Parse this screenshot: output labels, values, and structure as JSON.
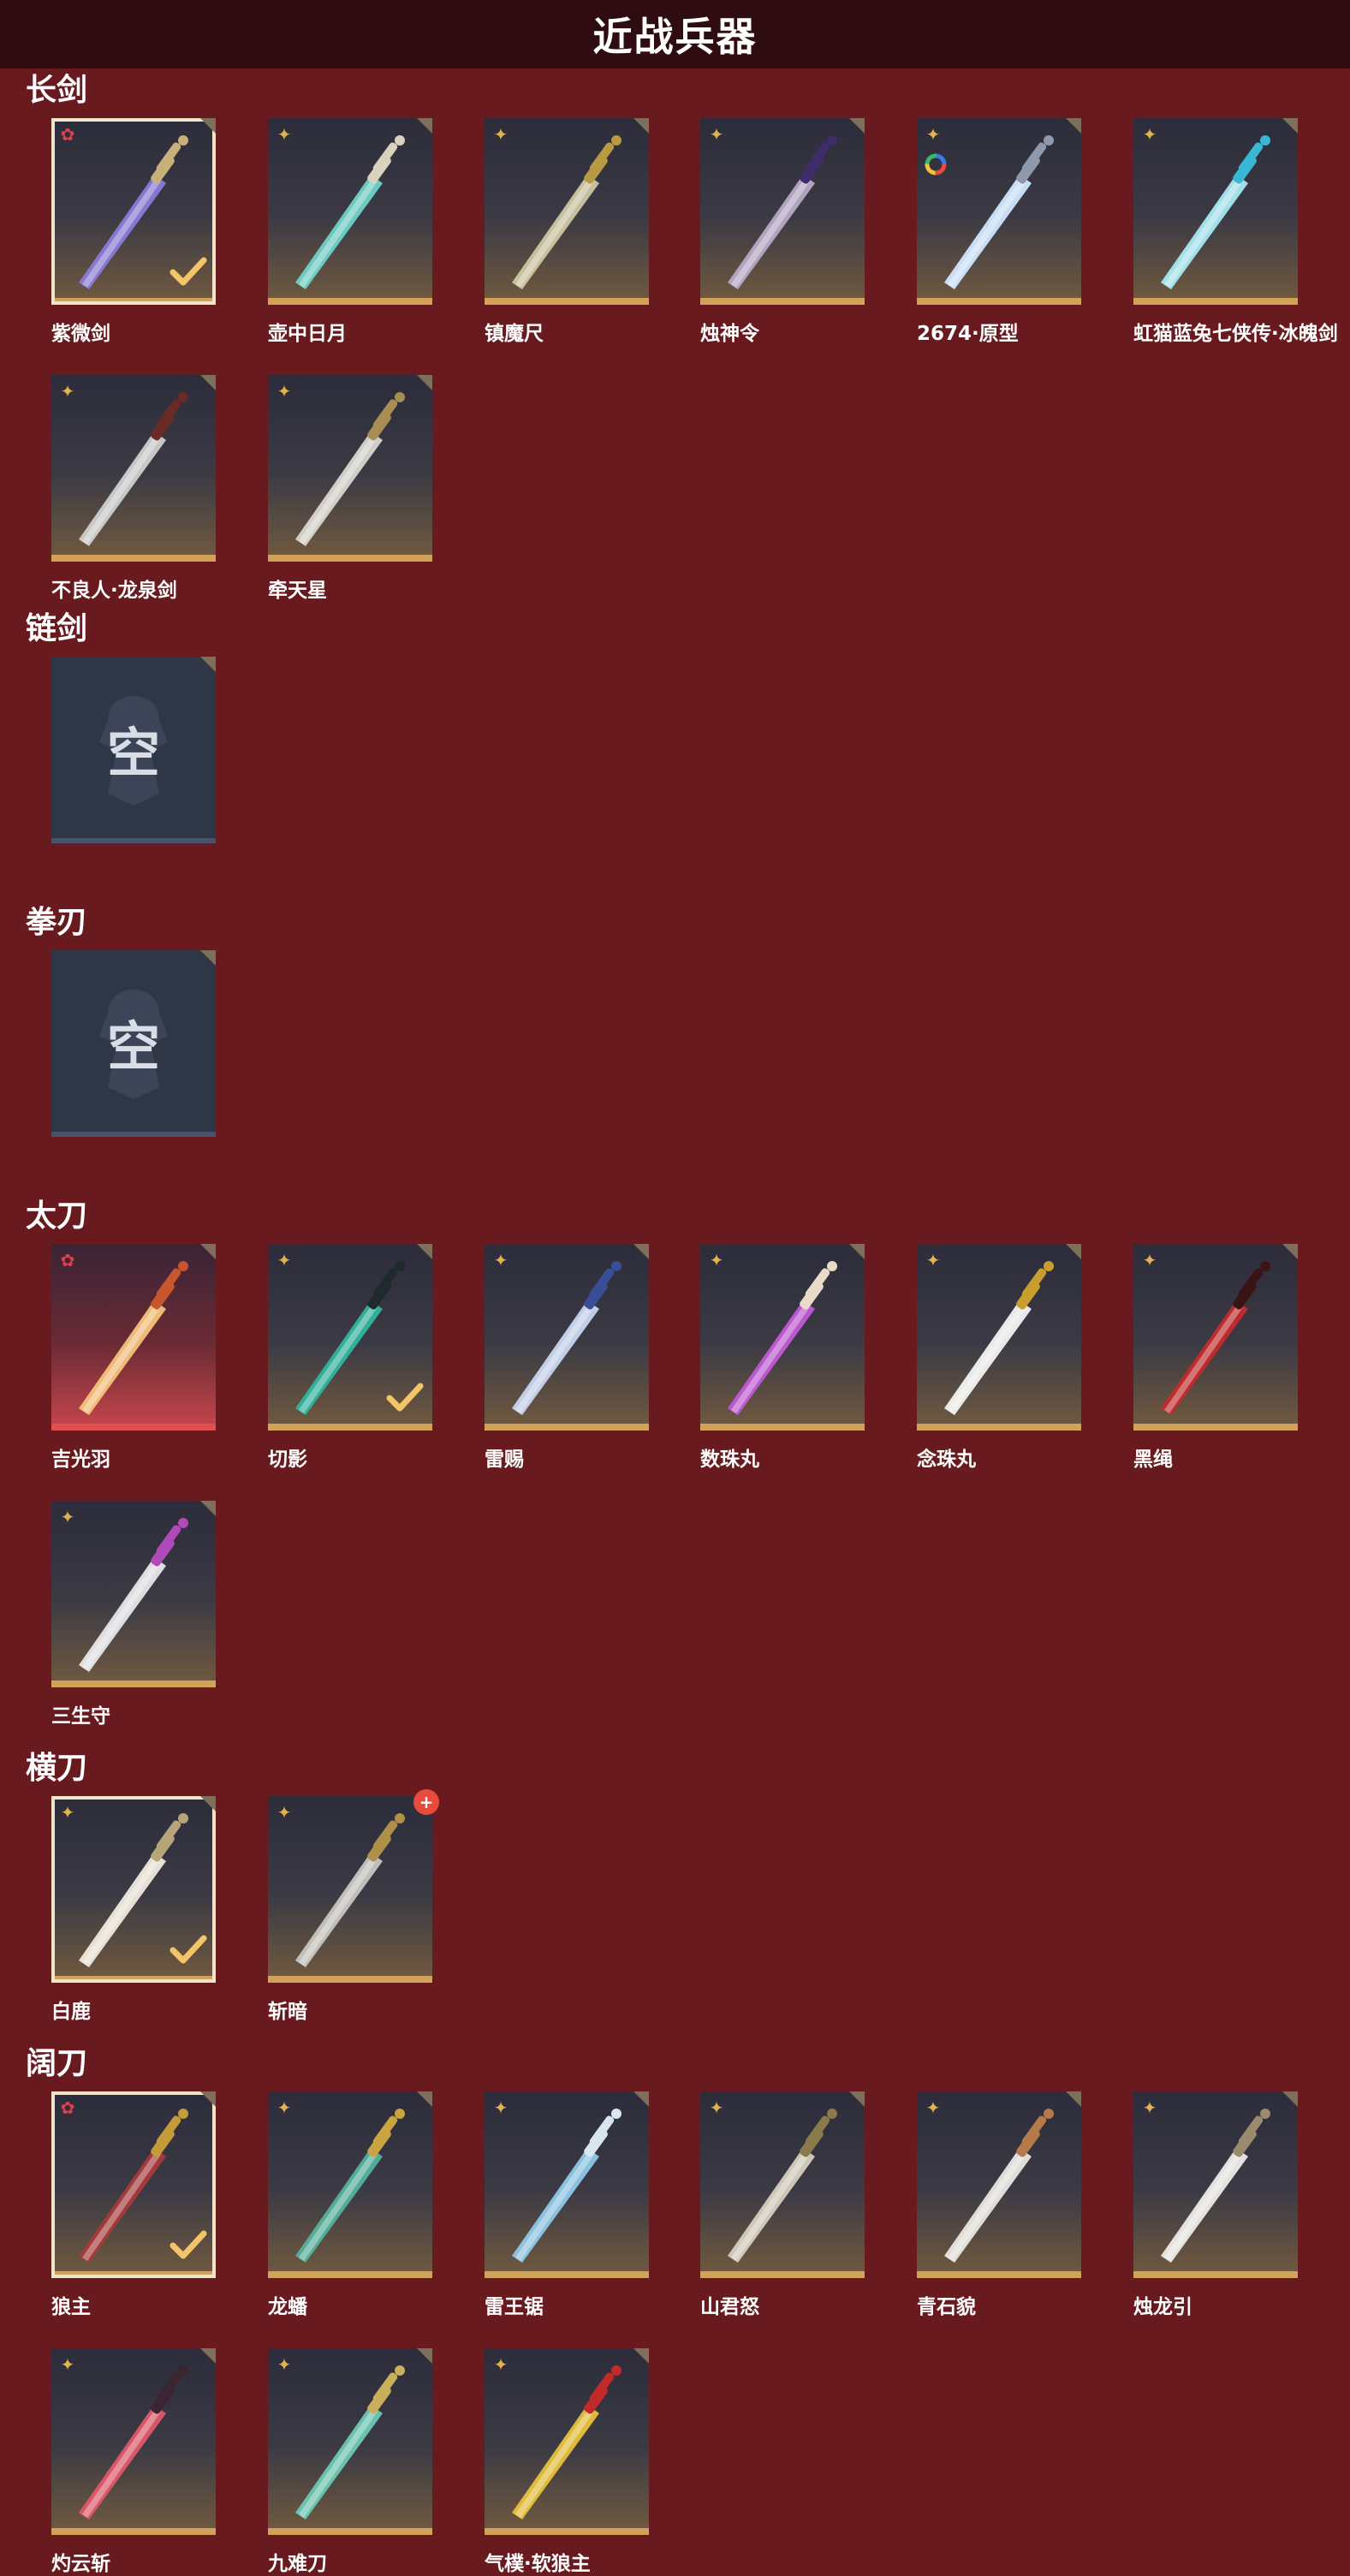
{
  "header": {
    "title": "近战兵器"
  },
  "sections": [
    {
      "name": "长剑",
      "items": [
        {
          "name": "紫微剑",
          "rarity": "red",
          "selected": true,
          "blade": "#8a7ad8",
          "hilt": "#c7b07a"
        },
        {
          "name": "壶中日月",
          "rarity": "gold",
          "blade": "#6fd2c8",
          "hilt": "#d9d2bd"
        },
        {
          "name": "镇魔尺",
          "rarity": "gold",
          "blade": "#cfc6a2",
          "hilt": "#b79a42"
        },
        {
          "name": "烛神令",
          "rarity": "gold",
          "blade": "#b7a9c7",
          "hilt": "#3e2d6a"
        },
        {
          "name": "2674·原型",
          "rarity": "gold",
          "special": "ring",
          "blade": "#cfe6ff",
          "hilt": "#8f99ad"
        },
        {
          "name": "虹猫蓝兔七侠传·冰魄剑",
          "rarity": "gold",
          "blade": "#a7e8f2",
          "hilt": "#39b8d4"
        },
        {
          "name": "不良人·龙泉剑",
          "rarity": "gold",
          "blade": "#cfcfcf",
          "hilt": "#6a2a25"
        },
        {
          "name": "牵天星",
          "rarity": "gold",
          "blade": "#d8d6d0",
          "hilt": "#a88e54"
        }
      ]
    },
    {
      "name": "链剑",
      "empty_label": "空",
      "items": []
    },
    {
      "name": "拳刃",
      "empty_label": "空",
      "items": []
    },
    {
      "name": "太刀",
      "items": [
        {
          "name": "吉光羽",
          "rarity": "red",
          "featured": true,
          "blade": "#f6c27a",
          "hilt": "#c7562f"
        },
        {
          "name": "切影",
          "rarity": "gold",
          "selected_check": true,
          "blade": "#2fb59e",
          "hilt": "#1e2a2b"
        },
        {
          "name": "雷赐",
          "rarity": "gold",
          "blade": "#c8d6f0",
          "hilt": "#3a4e98"
        },
        {
          "name": "数珠丸",
          "rarity": "gold",
          "blade": "#c25ad6",
          "hilt": "#e8dcc8"
        },
        {
          "name": "念珠丸",
          "rarity": "gold",
          "blade": "#f2f2f2",
          "hilt": "#c99e2e"
        },
        {
          "name": "黑绳",
          "rarity": "gold",
          "blade": "#c42a2a",
          "hilt": "#3a1414"
        },
        {
          "name": "三生守",
          "rarity": "gold",
          "blade": "#e6e6ea",
          "hilt": "#b04ab8"
        }
      ]
    },
    {
      "name": "横刀",
      "items": [
        {
          "name": "白鹿",
          "rarity": "gold",
          "selected": true,
          "blade": "#efe9dc",
          "hilt": "#b7a57a"
        },
        {
          "name": "斩暗",
          "rarity": "gold",
          "alert": true,
          "blade": "#c8c6c2",
          "hilt": "#b09048"
        }
      ]
    },
    {
      "name": "阔刀",
      "items": [
        {
          "name": "狼主",
          "rarity": "red",
          "selected": true,
          "blade": "#a83a3a",
          "hilt": "#c59a3a"
        },
        {
          "name": "龙蟠",
          "rarity": "gold",
          "blade": "#54b29e",
          "hilt": "#c9a440"
        },
        {
          "name": "雷王锯",
          "rarity": "gold",
          "blade": "#8ec8e8",
          "hilt": "#d8e6f0"
        },
        {
          "name": "山君怒",
          "rarity": "gold",
          "blade": "#d6cfbf",
          "hilt": "#8b7a4a"
        },
        {
          "name": "青石貌",
          "rarity": "gold",
          "blade": "#e8e6e2",
          "hilt": "#b57a4a"
        },
        {
          "name": "烛龙引",
          "rarity": "gold",
          "blade": "#ecebe8",
          "hilt": "#9a8a6e"
        },
        {
          "name": "灼云斩",
          "rarity": "gold",
          "blade": "#e2566a",
          "hilt": "#3a2530"
        },
        {
          "name": "九难刀",
          "rarity": "gold",
          "blade": "#6cc8b4",
          "hilt": "#c8b05a"
        },
        {
          "name": "气樸·软狼主",
          "rarity": "gold",
          "blade": "#e8c23a",
          "hilt": "#c22a2a"
        }
      ]
    }
  ]
}
